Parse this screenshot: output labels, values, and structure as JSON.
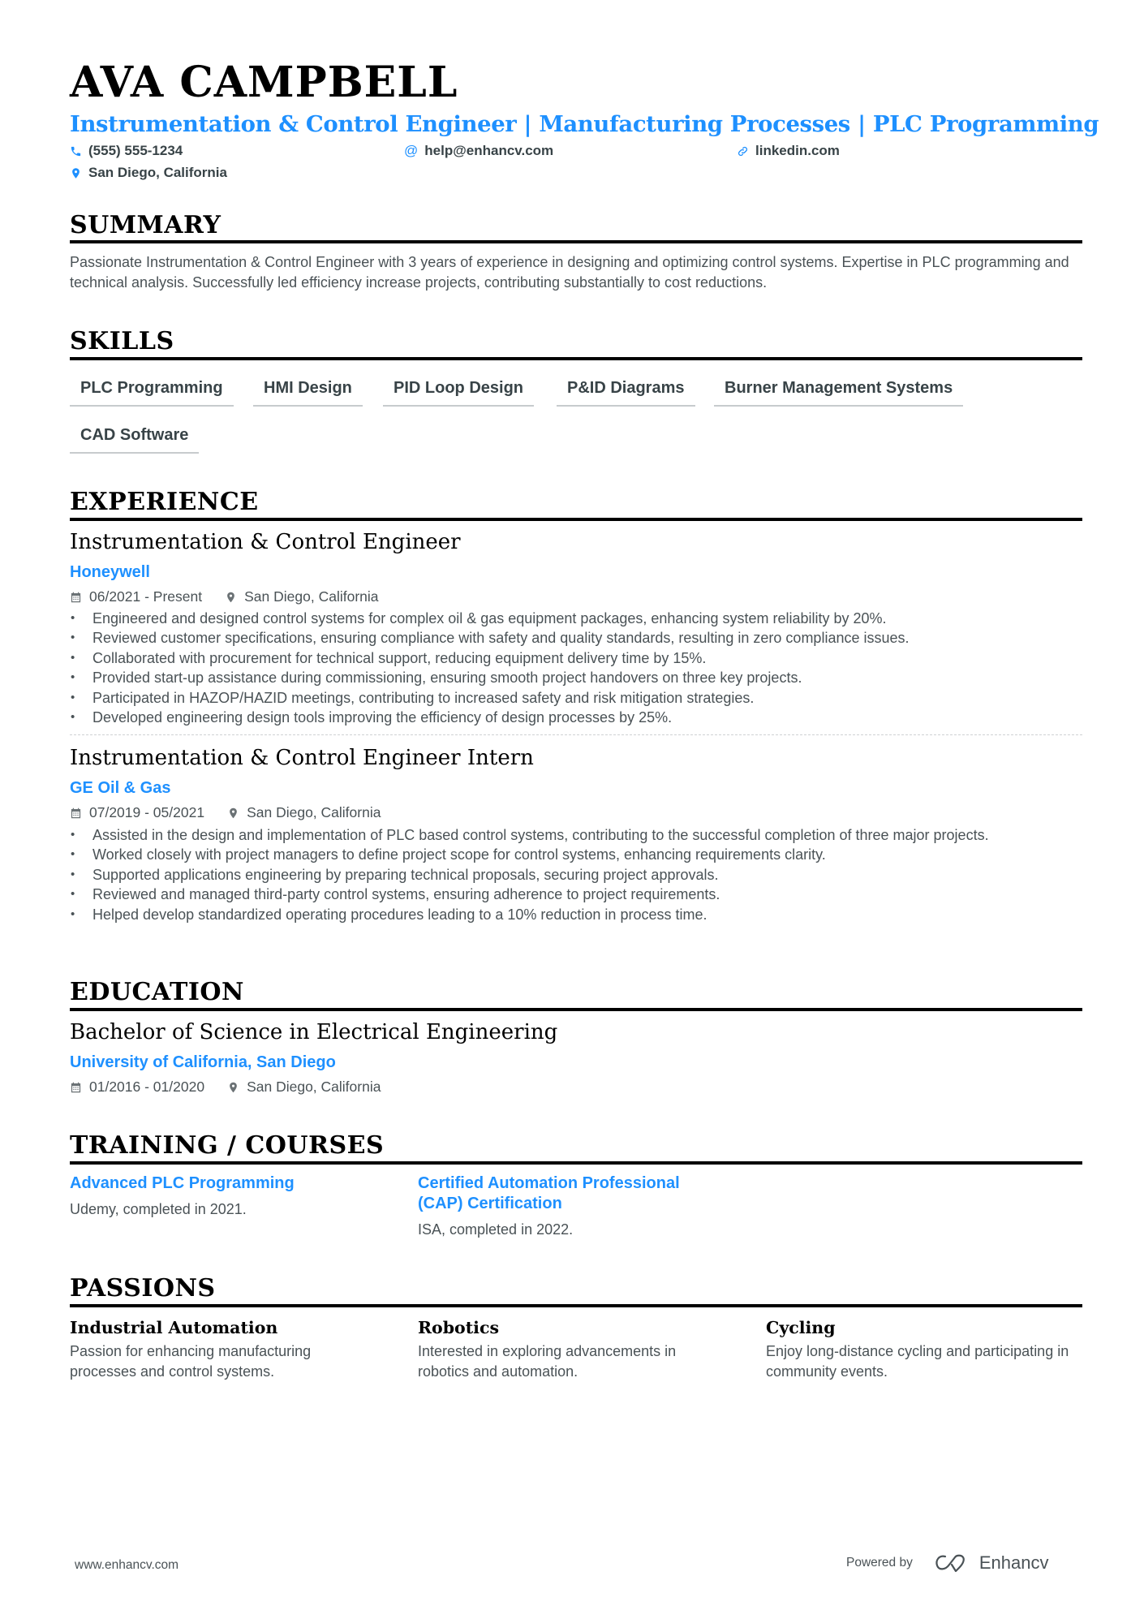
{
  "header": {
    "name": "AVA CAMPBELL",
    "headline": "Instrumentation & Control Engineer | Manufacturing Processes | PLC Programming",
    "contacts": [
      {
        "icon": "phone-icon",
        "text": "(555) 555-1234"
      },
      {
        "icon": "at-icon",
        "text": "help@enhancv.com"
      },
      {
        "icon": "link-icon",
        "text": "linkedin.com"
      },
      {
        "icon": "location-pin-icon",
        "text": "San Diego, California"
      }
    ]
  },
  "summary": {
    "title": "SUMMARY",
    "text": "Passionate Instrumentation & Control Engineer with 3 years of experience in designing and optimizing control systems. Expertise in PLC programming and technical analysis. Successfully led efficiency increase projects, contributing substantially to cost reductions."
  },
  "skills": {
    "title": "SKILLS",
    "items": [
      "PLC Programming",
      "HMI Design",
      "PID Loop Design",
      "P&ID Diagrams",
      "Burner Management Systems",
      "CAD Software"
    ]
  },
  "experience": {
    "title": "EXPERIENCE",
    "jobs": [
      {
        "title": "Instrumentation & Control Engineer",
        "company": "Honeywell",
        "dates": "06/2021 - Present",
        "location": "San Diego, California",
        "bullets": [
          "Engineered and designed control systems for complex oil & gas equipment packages, enhancing system reliability by 20%.",
          "Reviewed customer specifications, ensuring compliance with safety and quality standards, resulting in zero compliance issues.",
          "Collaborated with procurement for technical support, reducing equipment delivery time by 15%.",
          "Provided start-up assistance during commissioning, ensuring smooth project handovers on three key projects.",
          "Participated in HAZOP/HAZID meetings, contributing to increased safety and risk mitigation strategies.",
          "Developed engineering design tools improving the efficiency of design processes by 25%."
        ]
      },
      {
        "title": "Instrumentation & Control Engineer Intern",
        "company": "GE Oil & Gas",
        "dates": "07/2019 - 05/2021",
        "location": "San Diego, California",
        "bullets": [
          "Assisted in the design and implementation of PLC based control systems, contributing to the successful completion of three major projects.",
          "Worked closely with project managers to define project scope for control systems, enhancing requirements clarity.",
          "Supported applications engineering by preparing technical proposals, securing project approvals.",
          "Reviewed and managed third-party control systems, ensuring adherence to project requirements.",
          "Helped develop standardized operating procedures leading to a 10% reduction in process time."
        ]
      }
    ]
  },
  "education": {
    "title": "EDUCATION",
    "degree": "Bachelor of Science in Electrical Engineering",
    "school": "University of California, San Diego",
    "dates": "01/2016 - 01/2020",
    "location": "San Diego, California"
  },
  "training": {
    "title": "TRAINING / COURSES",
    "items": [
      {
        "title": "Advanced PLC Programming",
        "desc": "Udemy, completed in 2021."
      },
      {
        "title": "Certified Automation Professional (CAP) Certification",
        "desc": "ISA, completed in 2022."
      }
    ]
  },
  "passions": {
    "title": "PASSIONS",
    "items": [
      {
        "title": "Industrial Automation",
        "desc": "Passion for enhancing manufacturing processes and control systems."
      },
      {
        "title": "Robotics",
        "desc": "Interested in exploring advancements in robotics and automation."
      },
      {
        "title": "Cycling",
        "desc": "Enjoy long-distance cycling and participating in community events."
      }
    ]
  },
  "footer": {
    "website": "www.enhancv.com",
    "powered_by": "Powered by",
    "brand": "Enhancv"
  },
  "colors": {
    "accent": "#1E90FF",
    "heading": "#000000",
    "body_text": "#4a5256"
  }
}
